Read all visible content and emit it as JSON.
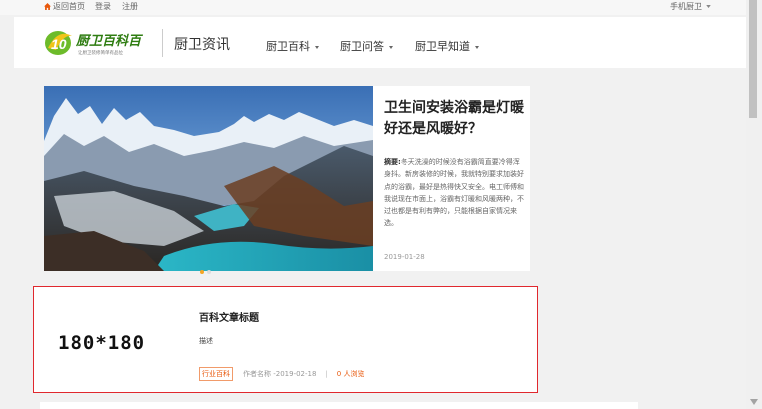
{
  "topbar": {
    "home_icon": "home-icon",
    "home_link": "返回首页",
    "login_link": "登录",
    "register_link": "注册",
    "mobile_link": "手机厨卫"
  },
  "header": {
    "logo_text": "厨卫百科百",
    "logo_slogan": "让厨卫装修简单有品位",
    "site_title": "厨卫资讯",
    "nav": [
      {
        "label": "厨卫百科"
      },
      {
        "label": "厨卫问答"
      },
      {
        "label": "厨卫早知道"
      }
    ]
  },
  "feature": {
    "title": "卫生间安装浴霸是灯暖好还是风暖好？",
    "summary_label": "摘要:",
    "summary": "冬天洗澡的时候没有浴霸简直要冷得浑身抖。新房装修的时候，我就特别要求加装好点的浴霸，最好是热得快又安全。电工师傅和我说现在市面上，浴霸有灯暖和风暖两种，不过也都是有利有弊的，只能根据自家情况来选。",
    "date": "2019-01-28"
  },
  "article": {
    "thumb_label": "180*180",
    "title": "百科文章标题",
    "description": "描述",
    "category": "行业百科",
    "author_date": "作者名称 -2019-02-18",
    "separator": "|",
    "views": "0 人浏览"
  },
  "colors": {
    "accent": "#e8580c",
    "highlight_border": "#e0282e",
    "logo_green": "#6dbb2a",
    "logo_yellow": "#f0c419"
  }
}
